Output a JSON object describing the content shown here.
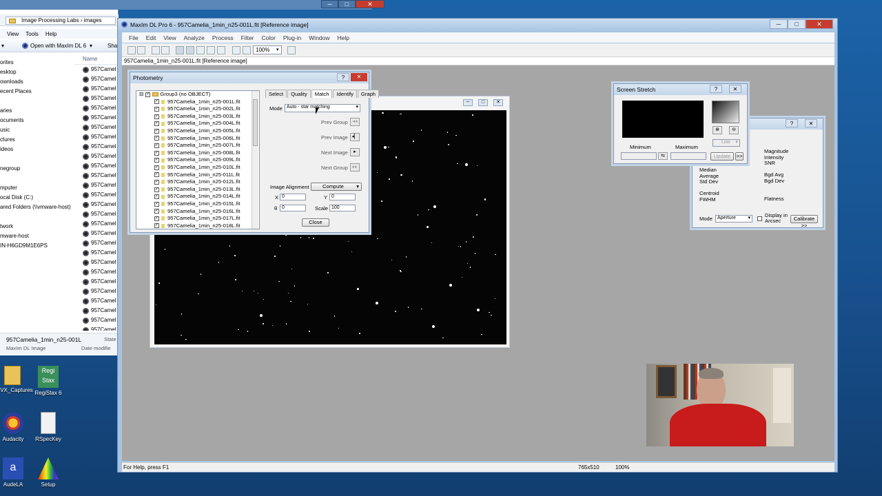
{
  "explorer": {
    "breadcrumb": [
      "Image Processing Labs",
      "images"
    ],
    "menu": [
      "View",
      "Tools",
      "Help"
    ],
    "toolbar": {
      "open_with": "Open with MaxIm DL 6",
      "share": "Sha"
    },
    "nav": [
      "orites",
      "esktop",
      "ownloads",
      "ecent Places",
      "",
      "aries",
      "ocuments",
      "usic",
      "ctures",
      "ideos",
      "",
      "negroup",
      "",
      "mputer",
      "ocal Disk (C:)",
      "ared Folders (\\\\vmware-host)",
      "",
      "twork",
      "mware-host",
      "IN-H6GD9M1E6PS"
    ],
    "files_header": "Name",
    "file_prefix": "957Camel",
    "footer": {
      "name": "957Camelia_1min_n25-001L",
      "type": "MaxIm DL Image",
      "state_label": "State",
      "date_label": "Date modifie"
    }
  },
  "desktop_icons": [
    {
      "label": "VX_Captures",
      "color": "#e9c35a"
    },
    {
      "label": "RegiStax 6",
      "color": "#3a8f5b"
    },
    {
      "label": "Audacity",
      "color": "#f0b228"
    },
    {
      "label": "RSpecKey",
      "color": "#f2f2f2"
    },
    {
      "label": "AudeLA",
      "color": "#2a4fb3"
    },
    {
      "label": "Setup",
      "color": "#3cad3c"
    }
  ],
  "maxim": {
    "title": "MaxIm DL Pro 6 - 957Camelia_1min_n25-001L.fit [Reference image]",
    "menu": [
      "File",
      "Edit",
      "View",
      "Analyze",
      "Process",
      "Filter",
      "Color",
      "Plug-in",
      "Window",
      "Help"
    ],
    "zoom": "100%",
    "doc_tab": "957Camelia_1min_n25-001L.fit [Reference image]",
    "status": {
      "help": "For Help, press F1",
      "size": "765x510",
      "zoom": "100%"
    }
  },
  "photometry": {
    "title": "Photometry",
    "group": "Group3 (no OBJECT)",
    "files": [
      "957Camelia_1min_n25-001L.fit",
      "957Camelia_1min_n25-002L.fit",
      "957Camelia_1min_n25-003L.fit",
      "957Camelia_1min_n25-004L.fit",
      "957Camelia_1min_n25-005L.fit",
      "957Camelia_1min_n25-006L.fit",
      "957Camelia_1min_n25-007L.fit",
      "957Camelia_1min_n25-008L.fit",
      "957Camelia_1min_n25-009L.fit",
      "957Camelia_1min_n25-010L.fit",
      "957Camelia_1min_n25-011L.fit",
      "957Camelia_1min_n25-012L.fit",
      "957Camelia_1min_n25-013L.fit",
      "957Camelia_1min_n25-014L.fit",
      "957Camelia_1min_n25-015L.fit",
      "957Camelia_1min_n25-016L.fit",
      "957Camelia_1min_n25-017L.fit",
      "957Camelia_1min_n25-018L.fit"
    ],
    "tabs": [
      "Select",
      "Quality",
      "Match",
      "Identify",
      "Graph"
    ],
    "mode_label": "Mode",
    "mode_value": "Auto - star matching",
    "prev_group": "Prev Group",
    "prev_image": "Prev Image",
    "next_image": "Next Image",
    "next_group": "Next Group",
    "image_alignment": "Image Alignment",
    "compute": "Compute",
    "x_label": "X",
    "x_value": "0",
    "y_label": "Y",
    "y_value": "0",
    "theta_label": "θ",
    "theta_value": "0",
    "scale_label": "Scale",
    "scale_value": "100",
    "close": "Close"
  },
  "screen_stretch": {
    "title": "Screen Stretch",
    "minimum": "Minimum",
    "maximum": "Maximum",
    "low": "Low",
    "update": "Update",
    "more": ">>"
  },
  "info_panel": {
    "left_labels": [
      "Median",
      "Average",
      "Std Dev",
      "",
      "Centroid",
      "FWHM"
    ],
    "right_labels": [
      "Magnitude",
      "Intensity",
      "SNR",
      "",
      "Bgd Avg",
      "Bgd Dev",
      "",
      "",
      "Flatness"
    ],
    "mode_label": "Mode",
    "mode_value": "Aperture",
    "display_arcsec": "Display in Arcsec",
    "calibrate": "Calibrate >>"
  }
}
